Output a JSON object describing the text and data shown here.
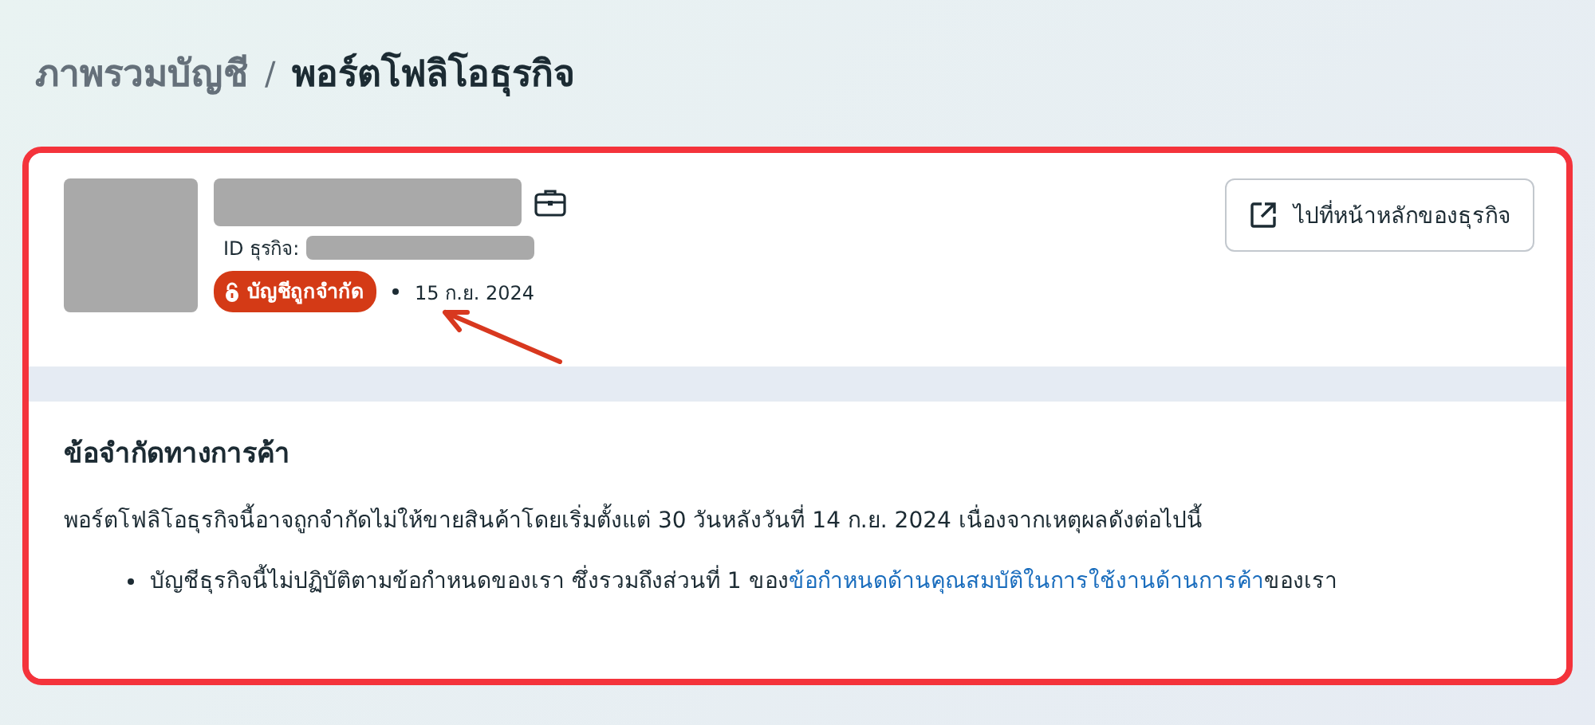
{
  "breadcrumb": [
    {
      "label": "ภาพรวมบัญชี",
      "selected": false
    },
    {
      "label": "พอร์ตโฟลิโอธุรกิจ",
      "selected": true
    }
  ],
  "breadcrumb_separator": "/",
  "business": {
    "id_label": "ID ธุรกิจ:",
    "status_badge": "บัญชีถูกจำกัด",
    "date": "15 ก.ย. 2024"
  },
  "home_button": "ไปที่หน้าหลักของธุรกิจ",
  "restrictions": {
    "title": "ข้อจำกัดทางการค้า",
    "description": "พอร์ตโฟลิโอธุรกิจนี้อาจถูกจำกัดไม่ให้ขายสินค้าโดยเริ่มตั้งแต่ 30 วันหลังวันที่ 14 ก.ย. 2024 เนื่องจากเหตุผลดังต่อไปนี้",
    "reasons": [
      {
        "text_before": "บัญชีธุรกิจนี้ไม่ปฏิบัติตามข้อกำหนดของเรา ซึ่งรวมถึงส่วนที่ 1 ของ",
        "link": "ข้อกำหนดด้านคุณสมบัติในการใช้งานด้านการค้า",
        "text_after": "ของเรา"
      }
    ]
  }
}
